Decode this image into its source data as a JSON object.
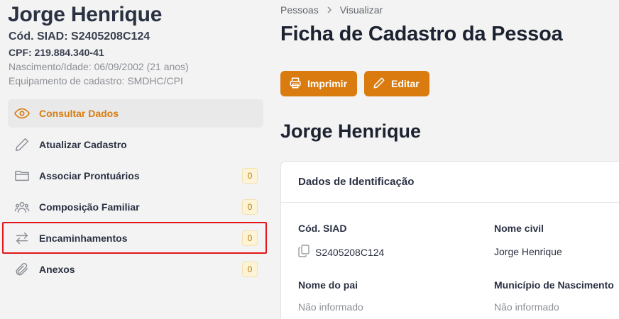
{
  "profile": {
    "name": "Jorge Henrique",
    "siad": "Cód. SIAD: S2405208C124",
    "cpf": "CPF: 219.884.340-41",
    "birth": "Nascimento/Idade: 06/09/2002 (21 anos)",
    "equipment": "Equipamento de cadastro: SMDHC/CPI"
  },
  "menu": {
    "items": [
      {
        "label": "Consultar Dados",
        "icon": "eye-icon"
      },
      {
        "label": "Atualizar Cadastro",
        "icon": "pencil-icon"
      },
      {
        "label": "Associar Prontuários",
        "icon": "folder-icon",
        "badge": "0"
      },
      {
        "label": "Composição Familiar",
        "icon": "users-icon",
        "badge": "0"
      },
      {
        "label": "Encaminhamentos",
        "icon": "arrows-exchange-icon",
        "badge": "0"
      },
      {
        "label": "Anexos",
        "icon": "paperclip-icon",
        "badge": "0"
      }
    ]
  },
  "breadcrumb": {
    "first": "Pessoas",
    "second": "Visualizar"
  },
  "page": {
    "title": "Ficha de Cadastro da Pessoa"
  },
  "actions": {
    "print": "Imprimir",
    "edit": "Editar"
  },
  "person_heading": "Jorge Henrique",
  "card": {
    "title": "Dados de Identificação",
    "siad_label": "Cód. SIAD",
    "siad_value": "S2405208C124",
    "civil_name_label": "Nome civil",
    "civil_name_value": "Jorge Henrique",
    "father_label": "Nome do pai",
    "father_value": "Não informado",
    "birthplace_label": "Município de Nascimento",
    "birthplace_value": "Não informado"
  },
  "colors": {
    "accent": "#d97b0f",
    "highlight": "#e0161b",
    "badge_bg": "#fdf3d6"
  }
}
